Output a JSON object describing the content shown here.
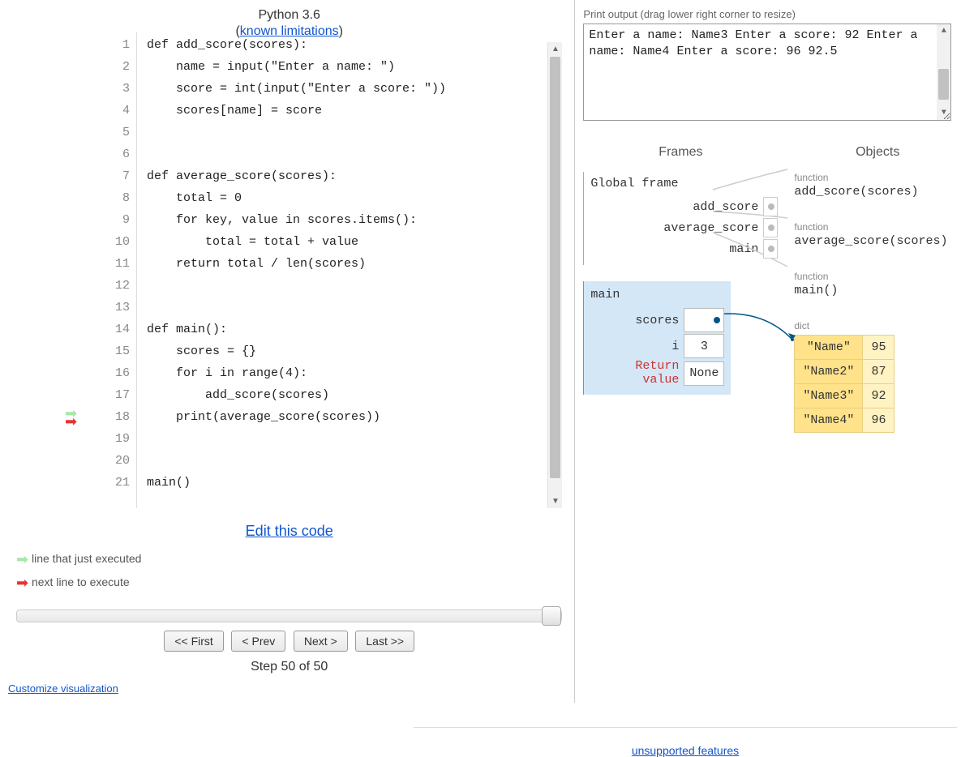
{
  "header": {
    "language": "Python 3.6",
    "known_limitations": "known limitations"
  },
  "code": {
    "first_line_no": 1,
    "lines": [
      "def add_score(scores):",
      "    name = input(\"Enter a name: \")",
      "    score = int(input(\"Enter a score: \"))",
      "    scores[name] = score",
      "",
      "",
      "def average_score(scores):",
      "    total = 0",
      "    for key, value in scores.items():",
      "        total = total + value",
      "    return total / len(scores)",
      "",
      "",
      "def main():",
      "    scores = {}",
      "    for i in range(4):",
      "        add_score(scores)",
      "    print(average_score(scores))",
      "",
      "",
      "main()"
    ],
    "just_executed_line": 18,
    "next_line": 18
  },
  "edit_link": "Edit this code",
  "legend": {
    "just_executed": "line that just executed",
    "next_line": "next line to execute"
  },
  "controls": {
    "first": "<< First",
    "prev": "< Prev",
    "next": "Next >",
    "last": "Last >>",
    "step_label": "Step 50 of 50"
  },
  "customize_link": "Customize visualization",
  "output": {
    "label": "Print output (drag lower right corner to resize)",
    "lines": [
      "Enter a name: Name3",
      "Enter a score: 92",
      "Enter a name: Name4",
      "Enter a score: 96",
      "92.5"
    ]
  },
  "viz": {
    "frames_header": "Frames",
    "objects_header": "Objects",
    "global_frame_title": "Global frame",
    "global_vars": [
      "add_score",
      "average_score",
      "main"
    ],
    "main_frame": {
      "title": "main",
      "scores_label": "scores",
      "i_label": "i",
      "i_value": "3",
      "return_label_1": "Return",
      "return_label_2": "value",
      "return_value": "None"
    },
    "objects": {
      "func_type": "function",
      "func1": "add_score(scores)",
      "func2": "average_score(scores)",
      "func3": "main()",
      "dict_type": "dict",
      "dict_entries": [
        {
          "k": "\"Name\"",
          "v": "95"
        },
        {
          "k": "\"Name2\"",
          "v": "87"
        },
        {
          "k": "\"Name3\"",
          "v": "92"
        },
        {
          "k": "\"Name4\"",
          "v": "96"
        }
      ]
    }
  },
  "footer_link": "unsupported features"
}
